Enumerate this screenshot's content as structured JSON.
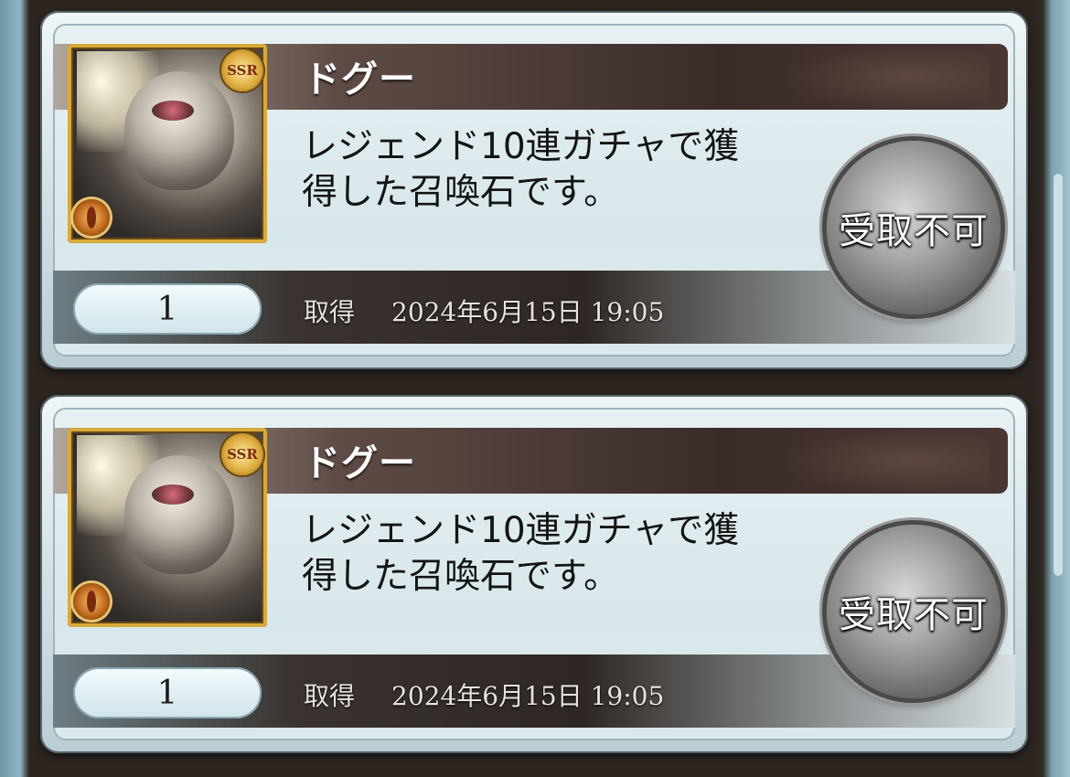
{
  "items": [
    {
      "name": "ドグー",
      "description": "レジェンド10連ガチャで獲\n得した召喚石です。",
      "count": "1",
      "acquired_label": "取得",
      "acquired_date": "2024年6月15日 19:05",
      "rarity_badge": "SSR",
      "receive_button_label": "受取不可",
      "element_icon": "fire-element-icon"
    },
    {
      "name": "ドグー",
      "description": "レジェンド10連ガチャで獲\n得した召喚石です。",
      "count": "1",
      "acquired_label": "取得",
      "acquired_date": "2024年6月15日 19:05",
      "rarity_badge": "SSR",
      "receive_button_label": "受取不可",
      "element_icon": "fire-element-icon"
    }
  ],
  "colors": {
    "badge_gold": "#d9a83a",
    "name_band": "#3b2c29"
  }
}
